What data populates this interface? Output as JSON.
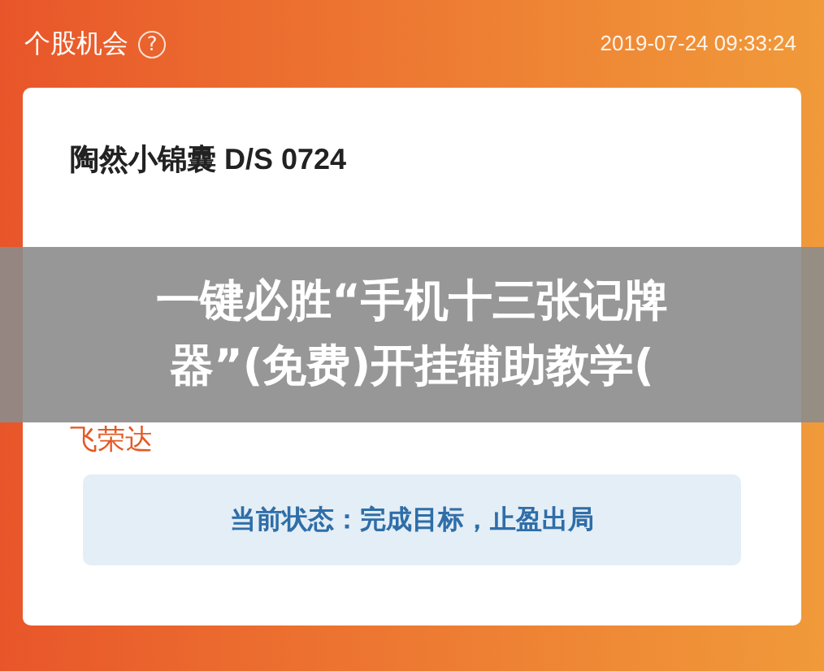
{
  "header": {
    "title": "个股机会",
    "help": "?",
    "timestamp": "2019-07-24 09:33:24"
  },
  "card": {
    "title": "陶然小锦囊 D/S 0724",
    "stock_name": "飞荣达",
    "status": "当前状态：完成目标，止盈出局"
  },
  "overlay": {
    "lines": [
      "一键必胜“手机十三张记牌",
      "器”(免费)开挂辅助教学("
    ]
  }
}
